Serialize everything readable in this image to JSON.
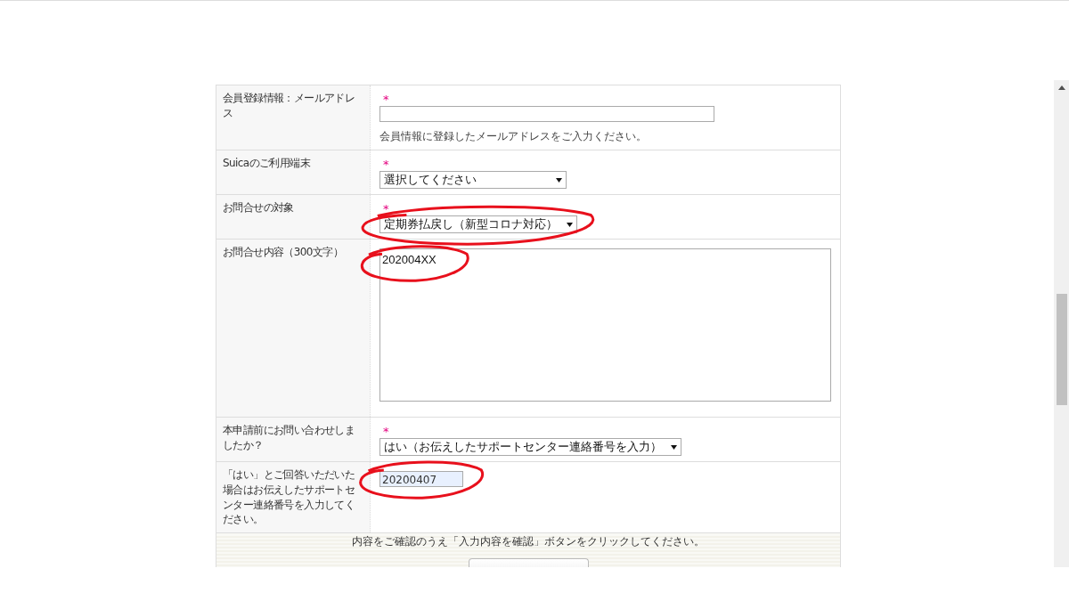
{
  "fields": [
    {
      "kind": "text",
      "label": "会員登録情報：メールアドレス",
      "required_mark": "*",
      "help": "会員情報に登録したメールアドレスをご入力ください。",
      "circled": false
    },
    {
      "kind": "select",
      "label": "Suicaのご利用端末",
      "required_mark": "*",
      "value": "選択してください",
      "circled": false
    },
    {
      "kind": "select",
      "label": "お問合せの対象",
      "required_mark": "*",
      "value": "定期券払戻し（新型コロナ対応）",
      "circled": true
    },
    {
      "kind": "textarea",
      "label": "お問合せ内容（300文字）",
      "value": "202004XX",
      "circled": true
    },
    {
      "kind": "select",
      "label": "本申請前にお問い合わせしましたか？",
      "required_mark": "*",
      "value": "はい（お伝えしたサポートセンター連絡番号を入力）",
      "circled": false
    },
    {
      "kind": "text",
      "label": "「はい」とご回答いただいた場合はお伝えしたサポートセンター連絡番号を入力してください。",
      "value": "20200407",
      "autofilled": true,
      "circled": true
    }
  ],
  "footer": {
    "note": "内容をご確認のうえ「入力内容を確認」ボタンをクリックしてください。"
  }
}
